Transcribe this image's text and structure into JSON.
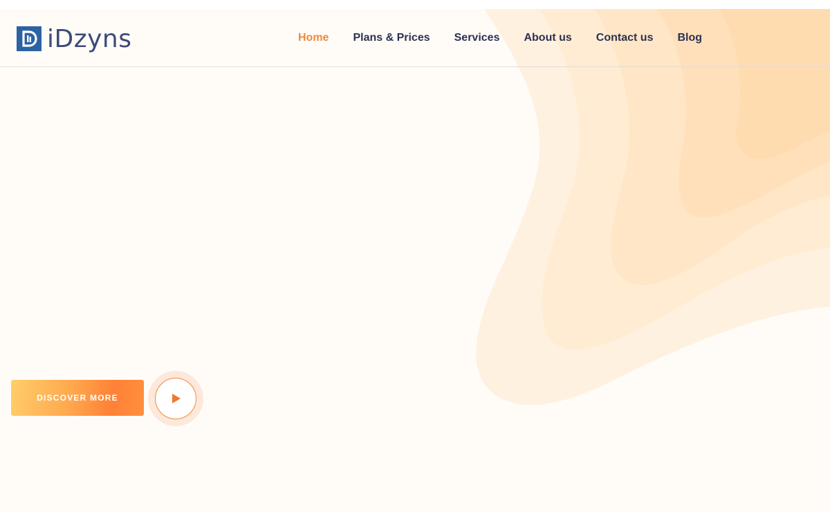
{
  "brand": {
    "name": "iDzyns",
    "icon": "logo-d-icon",
    "color": "#2b63a3"
  },
  "nav": {
    "items": [
      {
        "label": "Home",
        "active": true
      },
      {
        "label": "Plans & Prices",
        "active": false
      },
      {
        "label": "Services",
        "active": false
      },
      {
        "label": "About us",
        "active": false
      },
      {
        "label": "Contact us",
        "active": false
      },
      {
        "label": "Blog",
        "active": false
      }
    ]
  },
  "hero": {
    "cta_label": "DISCOVER MORE",
    "play_icon": "play-icon"
  },
  "colors": {
    "accent": "#ee8a3c",
    "nav_text": "#2d3150",
    "cta_gradient_start": "#ffcd6a",
    "cta_gradient_end": "#ff8135"
  }
}
